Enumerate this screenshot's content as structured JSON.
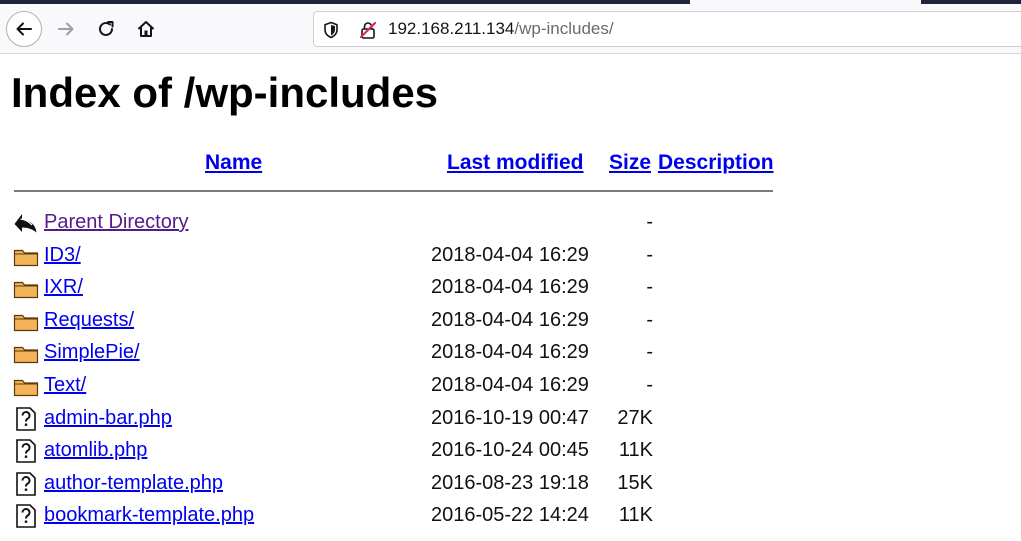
{
  "browser": {
    "url_host": "192.168.211.134",
    "url_path": "/wp-includes/"
  },
  "page": {
    "title": "Index of /wp-includes",
    "columns": {
      "name": "Name",
      "modified": "Last modified",
      "size": "Size",
      "description": "Description"
    }
  },
  "listing": [
    {
      "icon": "back-icon",
      "name": "Parent Directory",
      "modified": "",
      "size": "-"
    },
    {
      "icon": "folder-icon",
      "name": "ID3/",
      "modified": "2018-04-04 16:29",
      "size": "-"
    },
    {
      "icon": "folder-icon",
      "name": "IXR/",
      "modified": "2018-04-04 16:29",
      "size": "-"
    },
    {
      "icon": "folder-icon",
      "name": "Requests/",
      "modified": "2018-04-04 16:29",
      "size": "-"
    },
    {
      "icon": "folder-icon",
      "name": "SimplePie/",
      "modified": "2018-04-04 16:29",
      "size": "-"
    },
    {
      "icon": "folder-icon",
      "name": "Text/",
      "modified": "2018-04-04 16:29",
      "size": "-"
    },
    {
      "icon": "unknown-file-icon",
      "name": "admin-bar.php",
      "modified": "2016-10-19 00:47",
      "size": "27K"
    },
    {
      "icon": "unknown-file-icon",
      "name": "atomlib.php",
      "modified": "2016-10-24 00:45",
      "size": "11K"
    },
    {
      "icon": "unknown-file-icon",
      "name": "author-template.php",
      "modified": "2016-08-23 19:18",
      "size": "15K"
    },
    {
      "icon": "unknown-file-icon",
      "name": "bookmark-template.php",
      "modified": "2016-05-22 14:24",
      "size": "11K"
    }
  ],
  "colors": {
    "link": "#0000ee",
    "visited_link": "#551a8b",
    "folder": "#f3b35b",
    "insecure_lock": "#e22850"
  }
}
